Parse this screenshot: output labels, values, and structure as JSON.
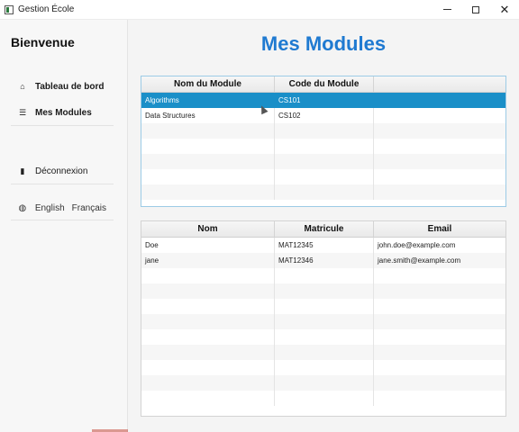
{
  "window": {
    "title": "Gestion École",
    "controls": {
      "minimize": "—",
      "maximize": "□",
      "close": "✕"
    }
  },
  "sidebar": {
    "welcome": "Bienvenue",
    "items": [
      {
        "label": "Tableau de bord",
        "icon": "home-icon",
        "glyph": "⌂"
      },
      {
        "label": "Mes Modules",
        "icon": "list-icon",
        "glyph": "☰"
      },
      {
        "label": "Déconnexion",
        "icon": "door-icon",
        "glyph": "▮"
      }
    ],
    "languages": {
      "icon": "globe-icon",
      "glyph": "◍",
      "english": "English",
      "french": "Français"
    }
  },
  "main": {
    "title": "Mes Modules",
    "modules_table": {
      "columns": [
        "Nom du Module",
        "Code du Module",
        ""
      ],
      "rows": [
        {
          "name": "Algorithms",
          "code": "CS101",
          "selected": true
        },
        {
          "name": "Data Structures",
          "code": "CS102",
          "selected": false
        }
      ]
    },
    "students_table": {
      "columns": [
        "Nom",
        "Matricule",
        "Email"
      ],
      "rows": [
        {
          "nom": "Doe",
          "matricule": "MAT12345",
          "email": "john.doe@example.com"
        },
        {
          "nom": "jane",
          "matricule": "MAT12346",
          "email": "jane.smith@example.com"
        }
      ]
    }
  },
  "colors": {
    "accent": "#1f7ad1",
    "selection": "#1a8fc8"
  }
}
